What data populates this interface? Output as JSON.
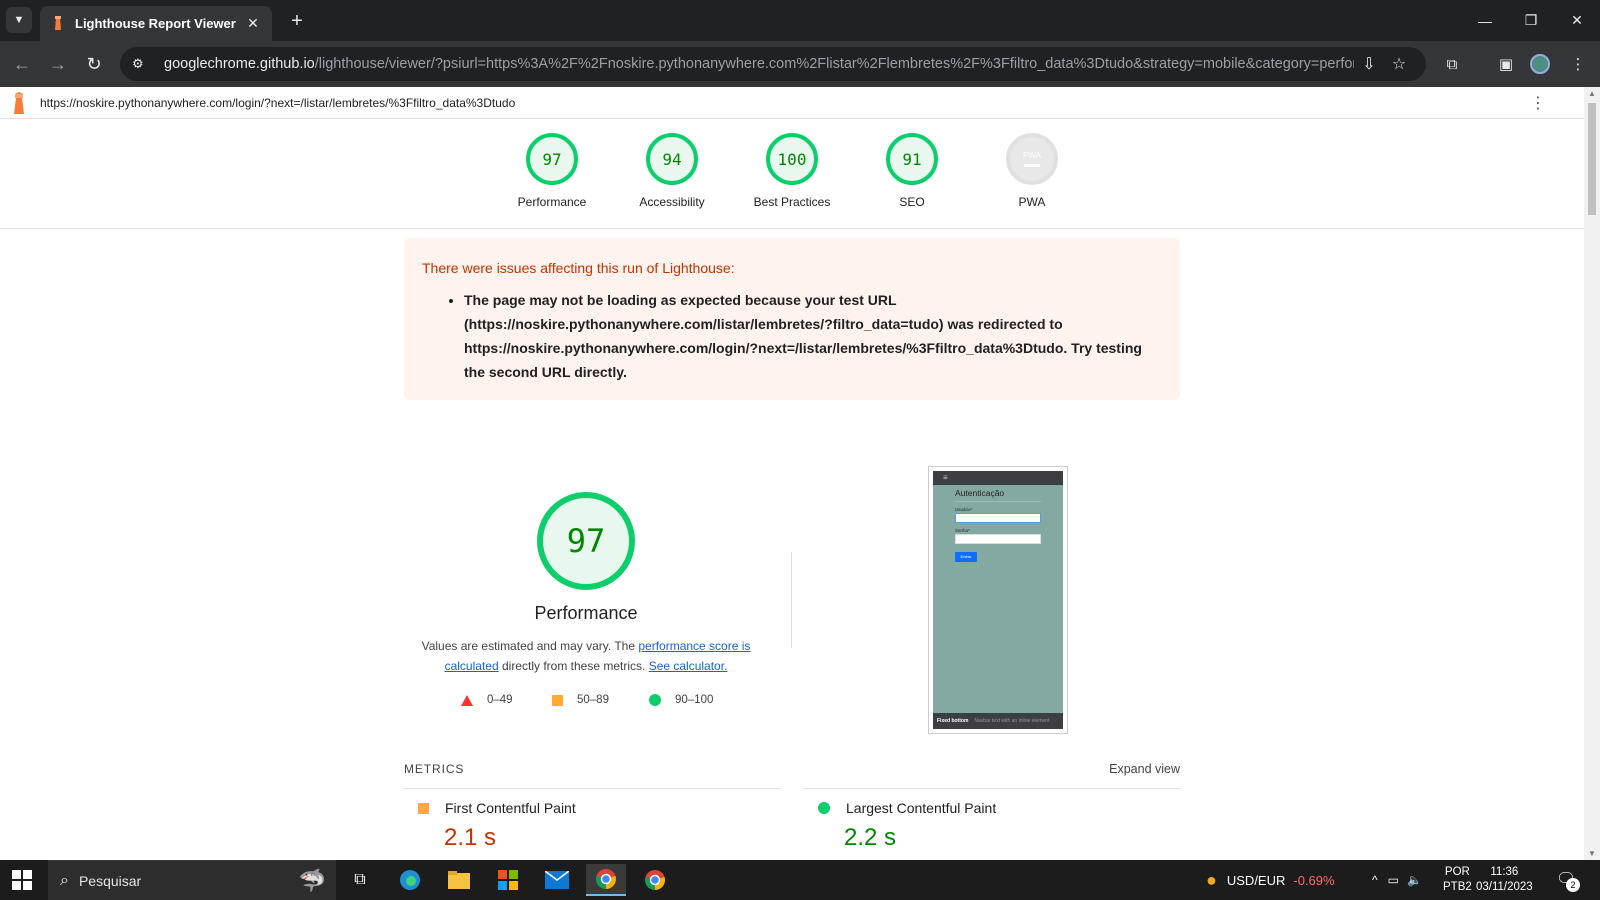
{
  "browser": {
    "tab_title": "Lighthouse Report Viewer",
    "url_host": "googlechrome.github.io",
    "url_rest": "/lighthouse/viewer/?psiurl=https%3A%2F%2Fnoskire.pythonanywhere.com%2Flistar%2Flembretes%2F%3Ffiltro_data%3Dtudo&strategy=mobile&category=performanc..."
  },
  "report": {
    "final_url": "https://noskire.pythonanywhere.com/login/?next=/listar/lembretes/%3Ffiltro_data%3Dtudo",
    "gauges": [
      {
        "score": "97",
        "label": "Performance"
      },
      {
        "score": "94",
        "label": "Accessibility"
      },
      {
        "score": "100",
        "label": "Best Practices"
      },
      {
        "score": "91",
        "label": "SEO"
      },
      {
        "score": "PWA",
        "label": "PWA"
      }
    ],
    "warning": {
      "title": "There were issues affecting this run of Lighthouse:",
      "items": [
        "The page may not be loading as expected because your test URL (https://noskire.pythonanywhere.com/listar/lembretes/?filtro_data=tudo) was redirected to https://noskire.pythonanywhere.com/login/?next=/listar/lembretes/%3Ffiltro_data%3Dtudo. Try testing the second URL directly."
      ]
    },
    "performance": {
      "score": "97",
      "title": "Performance",
      "desc_1": "Values are estimated and may vary. The ",
      "link_1": "performance score is calculated",
      "desc_2": " directly from these metrics. ",
      "link_2": "See calculator."
    },
    "legend": [
      {
        "range": "0–49",
        "color": "#ff3333"
      },
      {
        "range": "50–89",
        "color": "#ffaa33"
      },
      {
        "range": "90–100",
        "color": "#0cce6b"
      }
    ],
    "thumbnail": {
      "nav": "≡",
      "heading": "Autenticação",
      "user_label": "Usuário*",
      "pass_label": "Senha*",
      "button": "Entrar",
      "footer_left": "Fixed bottom",
      "footer_right": "Navbar text with an inline element"
    },
    "metrics": {
      "header": "METRICS",
      "expand": "Expand view",
      "items": [
        {
          "name": "First Contentful Paint",
          "value": "2.1 s",
          "color": "#c33300"
        },
        {
          "name": "Largest Contentful Paint",
          "value": "2.2 s",
          "color": "#008800"
        }
      ]
    }
  },
  "taskbar": {
    "search_placeholder": "Pesquisar",
    "ticker": "USD/EUR",
    "ticker_change": "-0.69%",
    "lang_1": "POR",
    "lang_2": "PTB2",
    "time": "11:36",
    "date": "03/11/2023",
    "notifications": "2"
  }
}
